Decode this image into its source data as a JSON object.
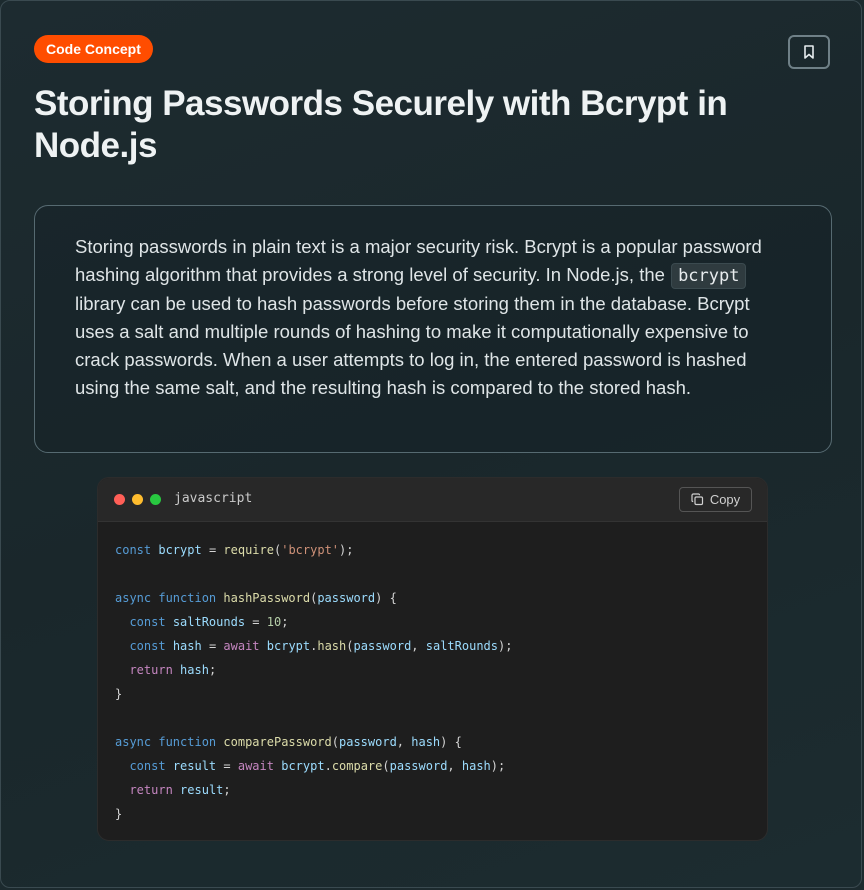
{
  "header": {
    "badge": "Code Concept",
    "title": "Storing Passwords Securely with Bcrypt in Node.js"
  },
  "description": {
    "before": "Storing passwords in plain text is a major security risk. Bcrypt is a popular password hashing algorithm that provides a strong level of security. In Node.js, the ",
    "inline_code": "bcrypt",
    "after": " library can be used to hash passwords before storing them in the database. Bcrypt uses a salt and multiple rounds of hashing to make it computationally expensive to crack passwords. When a user attempts to log in, the entered password is hashed using the same salt, and the resulting hash is compared to the stored hash."
  },
  "code_block": {
    "language": "javascript",
    "copy_label": "Copy",
    "lines": [
      [
        [
          "kw",
          "const"
        ],
        [
          "pun",
          " "
        ],
        [
          "var",
          "bcrypt"
        ],
        [
          "pun",
          " = "
        ],
        [
          "fn",
          "require"
        ],
        [
          "pun",
          "("
        ],
        [
          "str",
          "'bcrypt'"
        ],
        [
          "pun",
          ");"
        ]
      ],
      [],
      [
        [
          "kw",
          "async"
        ],
        [
          "pun",
          " "
        ],
        [
          "kw",
          "function"
        ],
        [
          "pun",
          " "
        ],
        [
          "fn",
          "hashPassword"
        ],
        [
          "pun",
          "("
        ],
        [
          "var",
          "password"
        ],
        [
          "pun",
          ") {"
        ]
      ],
      [
        [
          "pun",
          "  "
        ],
        [
          "kw",
          "const"
        ],
        [
          "pun",
          " "
        ],
        [
          "var",
          "saltRounds"
        ],
        [
          "pun",
          " = "
        ],
        [
          "num",
          "10"
        ],
        [
          "pun",
          ";"
        ]
      ],
      [
        [
          "pun",
          "  "
        ],
        [
          "kw",
          "const"
        ],
        [
          "pun",
          " "
        ],
        [
          "var",
          "hash"
        ],
        [
          "pun",
          " = "
        ],
        [
          "kw2",
          "await"
        ],
        [
          "pun",
          " "
        ],
        [
          "var",
          "bcrypt"
        ],
        [
          "pun",
          "."
        ],
        [
          "fn",
          "hash"
        ],
        [
          "pun",
          "("
        ],
        [
          "var",
          "password"
        ],
        [
          "pun",
          ", "
        ],
        [
          "var",
          "saltRounds"
        ],
        [
          "pun",
          ");"
        ]
      ],
      [
        [
          "pun",
          "  "
        ],
        [
          "kw2",
          "return"
        ],
        [
          "pun",
          " "
        ],
        [
          "var",
          "hash"
        ],
        [
          "pun",
          ";"
        ]
      ],
      [
        [
          "pun",
          "}"
        ]
      ],
      [],
      [
        [
          "kw",
          "async"
        ],
        [
          "pun",
          " "
        ],
        [
          "kw",
          "function"
        ],
        [
          "pun",
          " "
        ],
        [
          "fn",
          "comparePassword"
        ],
        [
          "pun",
          "("
        ],
        [
          "var",
          "password"
        ],
        [
          "pun",
          ", "
        ],
        [
          "var",
          "hash"
        ],
        [
          "pun",
          ") {"
        ]
      ],
      [
        [
          "pun",
          "  "
        ],
        [
          "kw",
          "const"
        ],
        [
          "pun",
          " "
        ],
        [
          "var",
          "result"
        ],
        [
          "pun",
          " = "
        ],
        [
          "kw2",
          "await"
        ],
        [
          "pun",
          " "
        ],
        [
          "var",
          "bcrypt"
        ],
        [
          "pun",
          "."
        ],
        [
          "fn",
          "compare"
        ],
        [
          "pun",
          "("
        ],
        [
          "var",
          "password"
        ],
        [
          "pun",
          ", "
        ],
        [
          "var",
          "hash"
        ],
        [
          "pun",
          ");"
        ]
      ],
      [
        [
          "pun",
          "  "
        ],
        [
          "kw2",
          "return"
        ],
        [
          "pun",
          " "
        ],
        [
          "var",
          "result"
        ],
        [
          "pun",
          ";"
        ]
      ],
      [
        [
          "pun",
          "}"
        ]
      ]
    ]
  },
  "icons": {
    "bookmark": "bookmark-icon",
    "copy": "copy-icon"
  },
  "colors": {
    "badge": "#ff4d00",
    "background": "#1c2a2e",
    "code_background": "#1e1e1e"
  }
}
